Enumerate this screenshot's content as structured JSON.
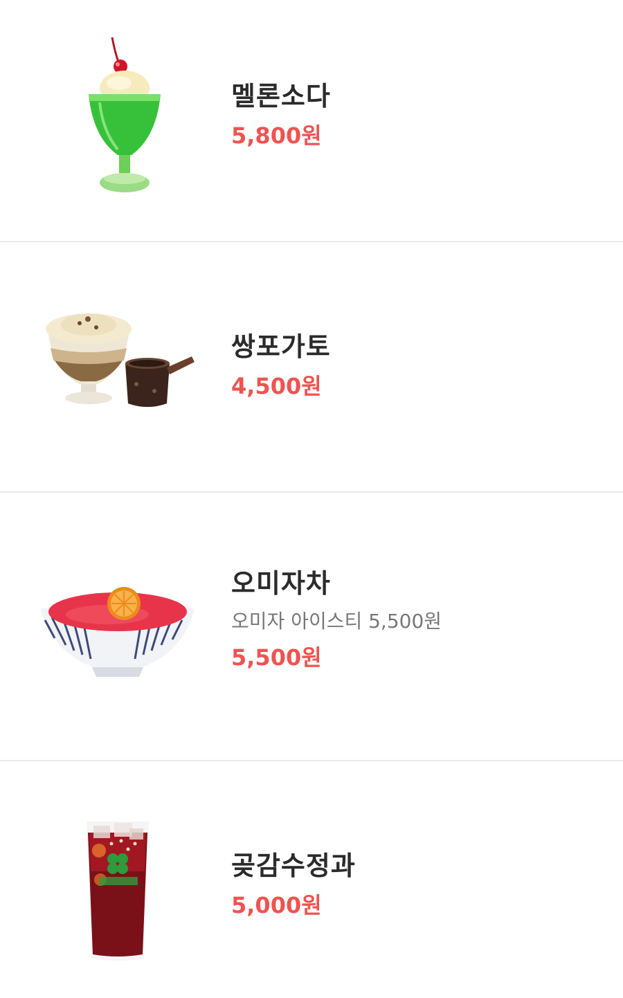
{
  "menu": {
    "items": [
      {
        "name": "멜론소다",
        "description": "",
        "price": "5,800원",
        "image_icon": "melon-soda-parfait-image"
      },
      {
        "name": "쌍포가토",
        "description": "",
        "price": "4,500원",
        "image_icon": "affogato-image"
      },
      {
        "name": "오미자차",
        "description": "오미자 아이스티 5,500원",
        "price": "5,500원",
        "image_icon": "omija-tea-bowl-image"
      },
      {
        "name": "곶감수정과",
        "description": "",
        "price": "5,000원",
        "image_icon": "persimmon-punch-glass-image"
      }
    ]
  },
  "colors": {
    "price_accent": "#ef5350",
    "name_text": "#2b2b2b",
    "desc_text": "#777777",
    "divider": "#eaeaea"
  }
}
